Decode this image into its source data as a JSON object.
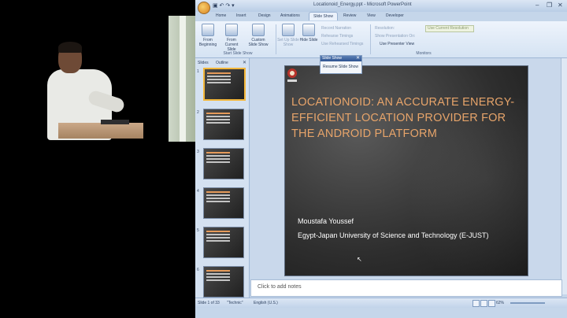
{
  "app": {
    "title": "Locationoid_Energy.ppt - Microsoft PowerPoint",
    "qat": "▣ ↶ ↷ ▾",
    "window_controls": [
      "–",
      "❐",
      "✕"
    ]
  },
  "ribbon": {
    "tabs": [
      "Home",
      "Insert",
      "Design",
      "Animations",
      "Slide Show",
      "Review",
      "View",
      "Developer"
    ],
    "active_tab": "Slide Show",
    "start_group": {
      "label": "Start Slide Show",
      "buttons": [
        "From Beginning",
        "From Current Slide",
        "Custom Slide Show"
      ]
    },
    "setup_buttons": [
      "Set Up Slide Show",
      "Hide Slide"
    ],
    "setup_small": [
      "Record Narration",
      "Rehearse Timings",
      "Use Rehearsed Timings"
    ],
    "monitor_small": [
      "Resolution:",
      "Show Presentation On:",
      "Use Presenter View"
    ],
    "field_value": "Use Current Resolution",
    "monitors_label": "Monitors"
  },
  "floating_toolbar": {
    "title": "Slide Show",
    "button": "Resume Slide Show"
  },
  "left_pane": {
    "tabs": [
      "Slides",
      "Outline"
    ],
    "close": "✕",
    "thumbnail_numbers": [
      "1",
      "2",
      "3",
      "4",
      "5",
      "6"
    ],
    "selected": 0
  },
  "slide": {
    "title": "Locationoid: An Accurate Energy-Efficient Location Provider for the Android Platform",
    "author": "Moustafa Youssef",
    "affiliation": "Egypt-Japan University of  Science and Technology (E-JUST)"
  },
  "notes": {
    "placeholder": "Click to add notes"
  },
  "status": {
    "slide": "Slide 1 of 33",
    "theme": "\"Technic\"",
    "language": "English (U.S.)",
    "zoom": "62%"
  },
  "colors": {
    "title_orange": "#e7a46a",
    "ribbon_blue": "#d5e3f3",
    "slide_dark": "#2e2e2e"
  }
}
